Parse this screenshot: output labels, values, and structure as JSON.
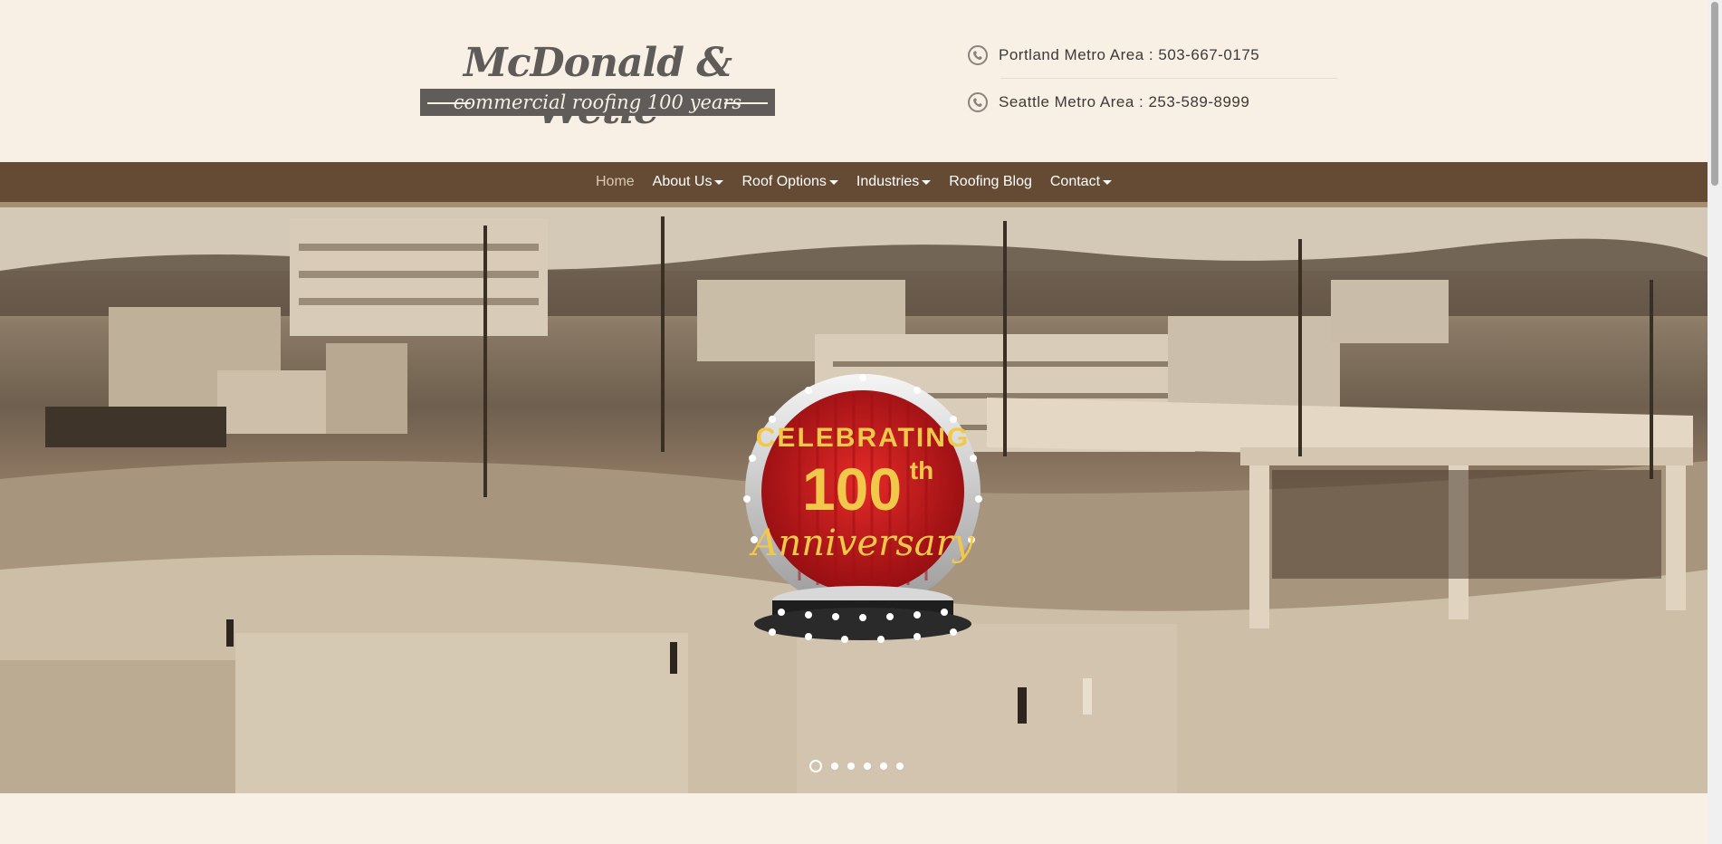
{
  "logo": {
    "title": "McDonald & Wetle",
    "tagline": "commercial roofing 100 years"
  },
  "contact": {
    "portland": "Portland Metro Area : 503-667-0175",
    "seattle": "Seattle Metro Area : 253-589-8999"
  },
  "nav": {
    "items": [
      {
        "label": "Home",
        "dropdown": false,
        "active": true
      },
      {
        "label": "About Us",
        "dropdown": true
      },
      {
        "label": "Roof Options",
        "dropdown": true
      },
      {
        "label": "Industries",
        "dropdown": true
      },
      {
        "label": "Roofing Blog",
        "dropdown": false
      },
      {
        "label": "Contact",
        "dropdown": true
      }
    ]
  },
  "hero": {
    "badge_line1": "CELEBRATING",
    "badge_number": "100",
    "badge_suffix": "th",
    "badge_line3": "Anniversary",
    "slide_count": 6,
    "active_slide": 1
  },
  "colors": {
    "nav_bg": "#654b33",
    "page_bg": "#f8f0e4",
    "badge_red": "#c8141a",
    "badge_gold": "#f2c84b"
  }
}
